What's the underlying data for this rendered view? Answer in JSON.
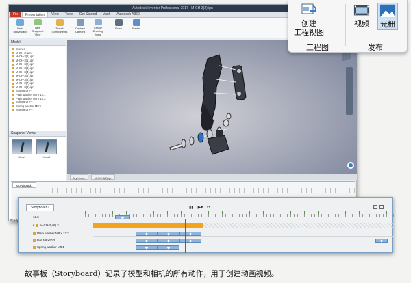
{
  "window": {
    "title": "Autodesk Inventor Professional 2017 - M-CH-3(2).ipn",
    "app_tab": "File",
    "tabs": [
      "Presentation",
      "View",
      "Tools",
      "Get Started",
      "Vault",
      "Autodesk A360"
    ]
  },
  "ribbon": {
    "buttons": [
      "New Storyboard",
      "New Snapshot View",
      "Tweak Components",
      "Capture Camera",
      "Create Drawing View",
      "Video",
      "Raster"
    ],
    "groups": [
      "Model",
      "Workshop",
      "Component",
      "Camera",
      "Drawing",
      "Publish"
    ]
  },
  "browser": {
    "header": "Model",
    "items": [
      "Scenes",
      "M-CH-3.iam",
      "M-CH-3(2).ipn",
      "M-CH-3(1).ipn",
      "M-CH-3(2).ipn",
      "M-CH-3(3).ipn",
      "M-CH-3(4).ipn",
      "M-CH-3(5).ipn",
      "M-CH-3(6).ipn",
      "M-CH-3(7).ipn",
      "M-CH-3(8).ipn",
      "Bolt M8x12:1",
      "Plain washer M8 x 12:1",
      "Plain washer M8 x 12:2",
      "Bolt M8x12:2",
      "Spring washer M8:1",
      "Bolt M8x12:3"
    ],
    "snapshot_header": "Snapshot Views",
    "snapshots": [
      "View1",
      "View2"
    ]
  },
  "viewport_tabs": [
    "My Home",
    "M-CH-3(2).ipn"
  ],
  "callout": {
    "btn_create_drawing_view": "创建\n工程视图",
    "btn_video": "视频",
    "btn_raster": "光栅",
    "group_drawing": "工程图",
    "group_publish": "发布"
  },
  "storyboard": {
    "tab": "Storyboard1",
    "small_tab": "Storyboard1",
    "scratch": "1 1 2 3 4",
    "root": "M-CH-3(46).2",
    "tracks": [
      "M-CH-3(46).2",
      "Plain washer M8 x 12:2",
      "Bolt M8x20:2",
      "Spring washer M8:1"
    ],
    "time_label": "12.5"
  },
  "status": "Ready",
  "caption": "故事板（Storyboard）记录了模型和相机的所有动作，用于创建动画视频。",
  "colors": {
    "accent_blue": "#2f7fd0",
    "playhead": "#c0392b",
    "orange_track": "#f3a41e",
    "action_block": "#8fb4dc"
  }
}
